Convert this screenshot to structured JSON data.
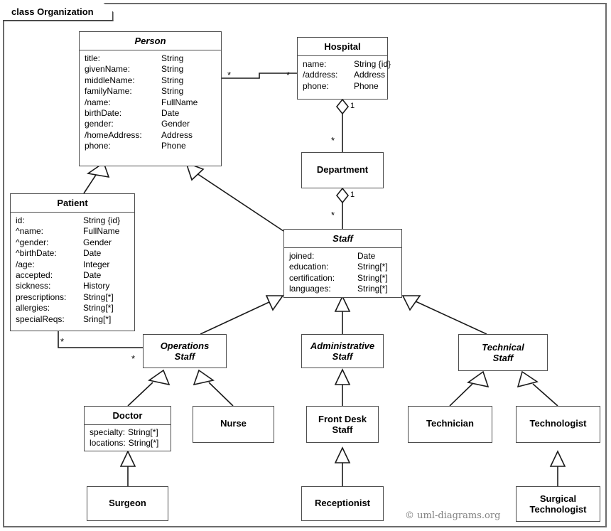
{
  "frame": {
    "label": "class Organization"
  },
  "copyright": "© uml-diagrams.org",
  "classes": {
    "person": {
      "name": "Person",
      "attrs": [
        {
          "name": "title:",
          "type": "String"
        },
        {
          "name": "givenName:",
          "type": "String"
        },
        {
          "name": "middleName:",
          "type": "String"
        },
        {
          "name": "familyName:",
          "type": "String"
        },
        {
          "name": "/name:",
          "type": "FullName"
        },
        {
          "name": "birthDate:",
          "type": "Date"
        },
        {
          "name": "gender:",
          "type": "Gender"
        },
        {
          "name": "/homeAddress:",
          "type": "Address"
        },
        {
          "name": "phone:",
          "type": "Phone"
        }
      ]
    },
    "hospital": {
      "name": "Hospital",
      "attrs": [
        {
          "name": "name:",
          "type": "String {id}"
        },
        {
          "name": "/address:",
          "type": "Address"
        },
        {
          "name": "phone:",
          "type": "Phone"
        }
      ]
    },
    "department": {
      "name": "Department",
      "attrs": []
    },
    "patient": {
      "name": "Patient",
      "attrs": [
        {
          "name": "id:",
          "type": "String {id}"
        },
        {
          "name": "^name:",
          "type": "FullName"
        },
        {
          "name": "^gender:",
          "type": "Gender"
        },
        {
          "name": "^birthDate:",
          "type": "Date"
        },
        {
          "name": "/age:",
          "type": "Integer"
        },
        {
          "name": "accepted:",
          "type": "Date"
        },
        {
          "name": "sickness:",
          "type": "History"
        },
        {
          "name": "prescriptions:",
          "type": "String[*]"
        },
        {
          "name": "allergies:",
          "type": "String[*]"
        },
        {
          "name": "specialReqs:",
          "type": "Sring[*]"
        }
      ]
    },
    "staff": {
      "name": "Staff",
      "attrs": [
        {
          "name": "joined:",
          "type": "Date"
        },
        {
          "name": "education:",
          "type": "String[*]"
        },
        {
          "name": "certification:",
          "type": "String[*]"
        },
        {
          "name": "languages:",
          "type": "String[*]"
        }
      ]
    },
    "operations_staff": {
      "name": "Operations\nStaff",
      "attrs": []
    },
    "administrative_staff": {
      "name": "Administrative\nStaff",
      "attrs": []
    },
    "technical_staff": {
      "name": "Technical\nStaff",
      "attrs": []
    },
    "doctor": {
      "name": "Doctor",
      "attrs": [
        {
          "name": "specialty:",
          "type": "String[*]"
        },
        {
          "name": "locations:",
          "type": "String[*]"
        }
      ]
    },
    "nurse": {
      "name": "Nurse",
      "attrs": []
    },
    "front_desk_staff": {
      "name": "Front Desk\nStaff",
      "attrs": []
    },
    "technician": {
      "name": "Technician",
      "attrs": []
    },
    "technologist": {
      "name": "Technologist",
      "attrs": []
    },
    "surgeon": {
      "name": "Surgeon",
      "attrs": []
    },
    "receptionist": {
      "name": "Receptionist",
      "attrs": []
    },
    "surgical_technologist": {
      "name": "Surgical\nTechnologist",
      "attrs": []
    }
  },
  "multiplicities": {
    "person_hospital_person_end": "*",
    "person_hospital_hospital_end": "*",
    "hospital_department_hospital_end": "1",
    "hospital_department_department_end": "*",
    "department_staff_department_end": "1",
    "department_staff_staff_end": "*",
    "patient_operations_patient_end": "*",
    "patient_operations_operations_end": "*"
  },
  "relationships": [
    {
      "name": "person-hospital-association",
      "type": "association",
      "from": "person",
      "to": "hospital"
    },
    {
      "name": "hospital-department-aggregation",
      "type": "aggregation",
      "from": "hospital",
      "to": "department"
    },
    {
      "name": "department-staff-aggregation",
      "type": "aggregation",
      "from": "department",
      "to": "staff"
    },
    {
      "name": "patient-operations-association",
      "type": "association",
      "from": "patient",
      "to": "operations_staff"
    },
    {
      "name": "patient-person-generalization",
      "type": "generalization",
      "from": "patient",
      "to": "person"
    },
    {
      "name": "staff-person-generalization",
      "type": "generalization",
      "from": "staff",
      "to": "person"
    },
    {
      "name": "operations-staff-generalization",
      "type": "generalization",
      "from": "operations_staff",
      "to": "staff"
    },
    {
      "name": "administrative-staff-generalization",
      "type": "generalization",
      "from": "administrative_staff",
      "to": "staff"
    },
    {
      "name": "technical-staff-generalization",
      "type": "generalization",
      "from": "technical_staff",
      "to": "staff"
    },
    {
      "name": "doctor-operations-generalization",
      "type": "generalization",
      "from": "doctor",
      "to": "operations_staff"
    },
    {
      "name": "nurse-operations-generalization",
      "type": "generalization",
      "from": "nurse",
      "to": "operations_staff"
    },
    {
      "name": "frontdesk-administrative-generalization",
      "type": "generalization",
      "from": "front_desk_staff",
      "to": "administrative_staff"
    },
    {
      "name": "technician-technical-generalization",
      "type": "generalization",
      "from": "technician",
      "to": "technical_staff"
    },
    {
      "name": "technologist-technical-generalization",
      "type": "generalization",
      "from": "technologist",
      "to": "technical_staff"
    },
    {
      "name": "surgeon-doctor-generalization",
      "type": "generalization",
      "from": "surgeon",
      "to": "doctor"
    },
    {
      "name": "receptionist-frontdesk-generalization",
      "type": "generalization",
      "from": "receptionist",
      "to": "front_desk_staff"
    },
    {
      "name": "surgical-technologist-generalization",
      "type": "generalization",
      "from": "surgical_technologist",
      "to": "technologist"
    }
  ]
}
